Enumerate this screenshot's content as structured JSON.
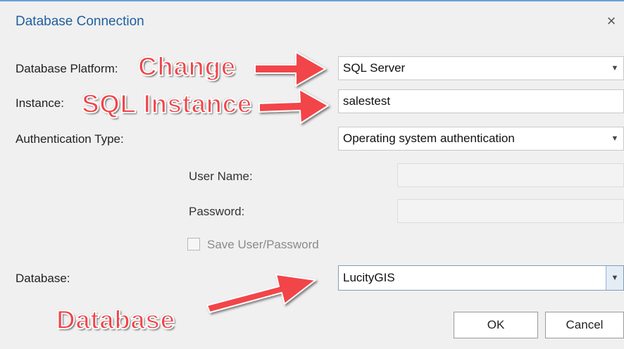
{
  "dialog": {
    "title": "Database Connection",
    "close_symbol": "×",
    "accent_color": "#1f5f9f"
  },
  "form": {
    "platform": {
      "label": "Database Platform:",
      "value": "SQL Server"
    },
    "instance": {
      "label": "Instance:",
      "value": "salestest"
    },
    "auth": {
      "label": "Authentication Type:",
      "value": "Operating system authentication"
    },
    "username": {
      "label": "User Name:",
      "value": ""
    },
    "password": {
      "label": "Password:",
      "value": ""
    },
    "save_checkbox": {
      "label": "Save User/Password",
      "checked": false
    },
    "database": {
      "label": "Database:",
      "value": "LucityGIS"
    }
  },
  "buttons": {
    "ok": "OK",
    "cancel": "Cancel"
  },
  "annotations": {
    "change": "Change",
    "sql_instance": "SQL Instance",
    "database": "Database",
    "color": "#f2454a"
  },
  "icons": {
    "dropdown": "chevron-down-icon",
    "close": "close-icon"
  }
}
